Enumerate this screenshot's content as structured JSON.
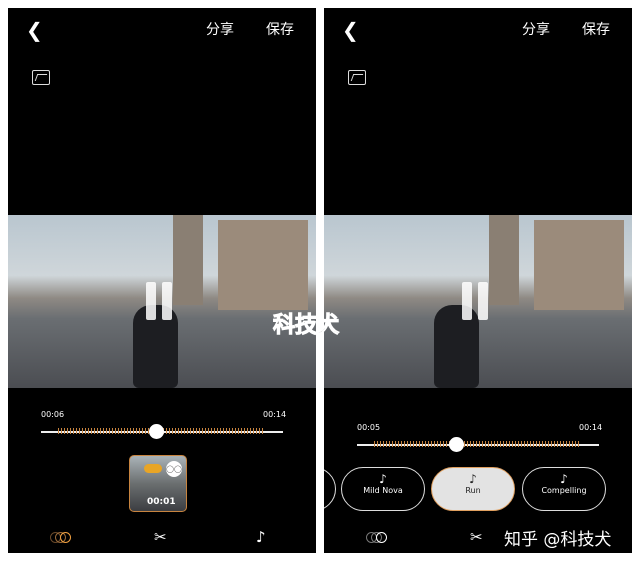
{
  "left": {
    "header": {
      "back_icon": "chevron-left",
      "share": "分享",
      "save": "保存"
    },
    "timeline": {
      "start": "00:06",
      "end": "00:14",
      "progress": 0.5
    },
    "clip": {
      "duration": "00:01",
      "transition_icon": "transition-circles"
    },
    "bottom_nav": [
      "transition-icon",
      "scissors-icon",
      "music-note-icon"
    ],
    "active_tab": "transition"
  },
  "right": {
    "header": {
      "back_icon": "chevron-left",
      "share": "分享",
      "save": "保存"
    },
    "timeline": {
      "start": "00:05",
      "end": "00:14",
      "progress": 0.4
    },
    "music": [
      {
        "label": "Mild Nova",
        "selected": false
      },
      {
        "label": "Run",
        "selected": true
      },
      {
        "label": "Compelling",
        "selected": false
      }
    ],
    "bottom_nav": [
      "transition-icon",
      "scissors-icon"
    ]
  },
  "watermark": "知乎 @科技犬",
  "sticker_text": "科技犬",
  "colors": {
    "accent": "#c8843f",
    "background": "#000000"
  }
}
